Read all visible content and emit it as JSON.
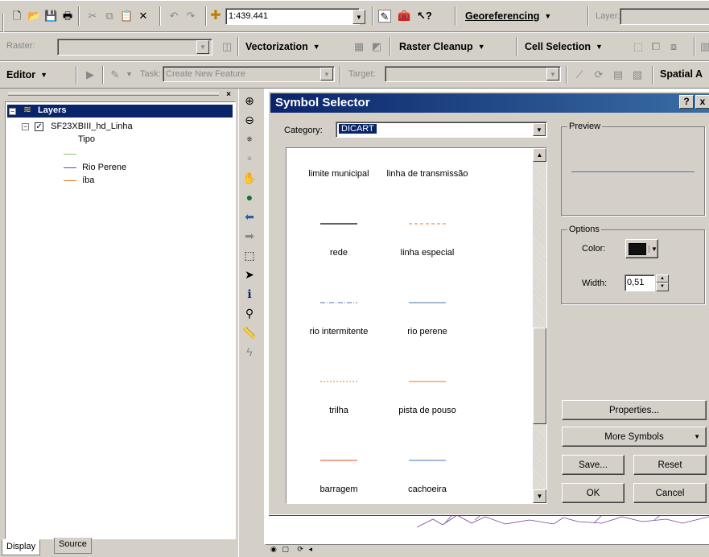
{
  "toolbar1": {
    "scale_value": "1:439.441",
    "georeferencing_label": "Georeferencing",
    "layer_label": "Layer:"
  },
  "toolbar2": {
    "raster_label": "Raster:",
    "vectorization_label": "Vectorization",
    "raster_cleanup_label": "Raster Cleanup",
    "cell_selection_label": "Cell Selection"
  },
  "toolbar3": {
    "editor_label": "Editor",
    "task_label": "Task:",
    "task_value": "Create New Feature",
    "target_label": "Target:",
    "spatial_label": "Spatial A"
  },
  "toc": {
    "layers_label": "Layers",
    "layer_name": "SF23XBIII_hd_Linha",
    "field_name": "Tipo",
    "legend": [
      {
        "label": "",
        "color": "#8dc26f"
      },
      {
        "label": "Rio Perene",
        "color": "#7b3fa0"
      },
      {
        "label": "íba",
        "color": "#e07b22"
      }
    ],
    "tabs": [
      "Display",
      "Source"
    ]
  },
  "dialog": {
    "title": "Symbol Selector",
    "help_btn": "?",
    "close_btn": "x",
    "category_label": "Category:",
    "category_value": "DICART",
    "preview_label": "Preview",
    "options_label": "Options",
    "color_label": "Color:",
    "width_label": "Width:",
    "width_value": "0,51",
    "properties_btn": "Properties...",
    "more_symbols_btn": "More Symbols",
    "save_btn": "Save...",
    "reset_btn": "Reset",
    "ok_btn": "OK",
    "cancel_btn": "Cancel",
    "symbols": [
      {
        "label": "limite  municipal",
        "color": "",
        "style": "none"
      },
      {
        "label": "linha de transmissão",
        "color": "",
        "style": "none"
      },
      {
        "label": "rede",
        "color": "#000000",
        "style": "solid"
      },
      {
        "label": "linha especial",
        "color": "#e07b22",
        "style": "dashed"
      },
      {
        "label": "rio intermitente",
        "color": "#4a72b8",
        "style": "dashdot"
      },
      {
        "label": "rio perene",
        "color": "#4a72b8",
        "style": "solid"
      },
      {
        "label": "trilha",
        "color": "#e07b22",
        "style": "dotted"
      },
      {
        "label": "pista de pouso",
        "color": "#e07b22",
        "style": "solid"
      },
      {
        "label": "barragem",
        "color": "#e04a22",
        "style": "solid"
      },
      {
        "label": "cachoeira",
        "color": "#4a72b8",
        "style": "solid"
      }
    ]
  }
}
